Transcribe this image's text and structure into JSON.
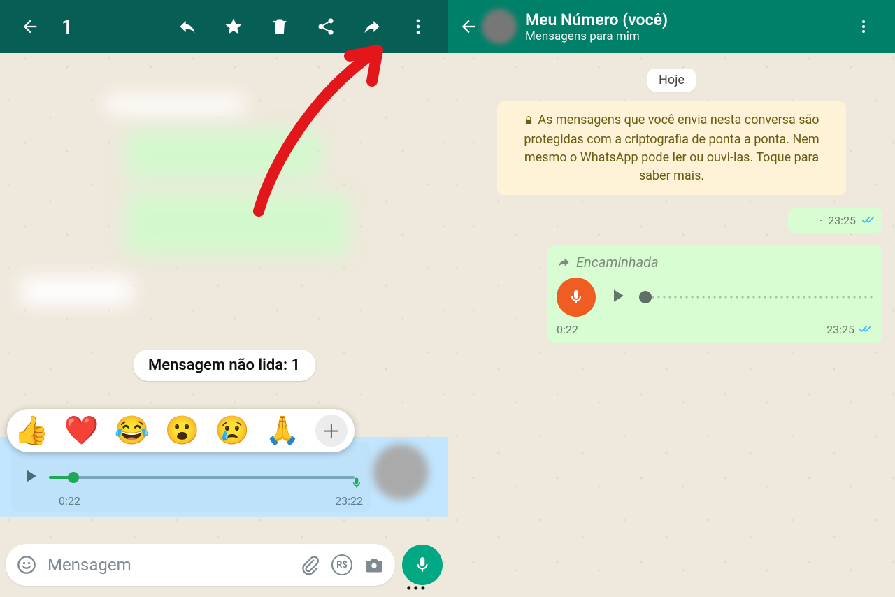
{
  "left": {
    "selection_count": "1",
    "unread_label": "Mensagem não lida: 1",
    "reactions": [
      "👍",
      "❤️",
      "😂",
      "😮",
      "😢",
      "🙏"
    ],
    "voice": {
      "duration": "0:22",
      "time": "23:22"
    },
    "input_placeholder": "Mensagem"
  },
  "right": {
    "title": "Meu Número (você)",
    "subtitle": "Mensagens para mim",
    "date_chip": "Hoje",
    "encryption_text": "As mensagens que você envia nesta conversa são protegidas com a criptografia de ponta a ponta. Nem mesmo o WhatsApp pode ler ou ouvi-las. Toque para saber mais.",
    "tiny_time": "23:25",
    "forwarded_label": "Encaminhada",
    "voice": {
      "duration": "0:22",
      "time": "23:25"
    }
  }
}
